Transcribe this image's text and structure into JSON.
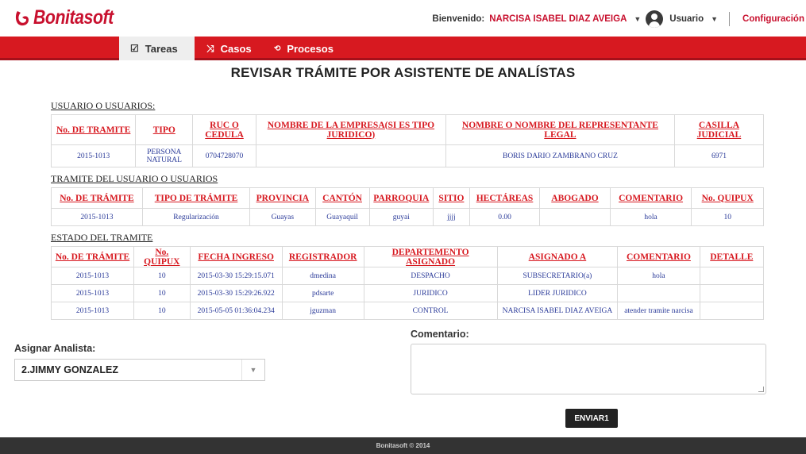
{
  "brand": {
    "name": "Bonitasoft"
  },
  "userbar": {
    "welcome": "Bienvenido:",
    "user_name": "NARCISA ISABEL DIAZ AVEIGA",
    "user_menu": "Usuario",
    "settings": "Configuración"
  },
  "nav": {
    "tabs": [
      {
        "label": "Tareas",
        "icon": "checkbox-icon"
      },
      {
        "label": "Casos",
        "icon": "shuffle-icon"
      },
      {
        "label": "Procesos",
        "icon": "process-icon"
      }
    ],
    "active_tab": "Tareas"
  },
  "page_title": "REVISAR TRÁMITE POR ASISTENTE DE ANALÍSTAS",
  "usuarios": {
    "title": "USUARIO O USUARIOS:",
    "headers": [
      "No. DE TRAMITE",
      "TIPO",
      "RUC O CEDULA",
      "NOMBRE DE LA EMPRESA(SI ES TIPO JURIDICO)",
      "NOMBRE O NOMBRE DEL REPRESENTANTE LEGAL",
      "CASILLA JUDICIAL"
    ],
    "rows": [
      [
        "2015-1013",
        "PERSONA NATURAL",
        "0704728070",
        "",
        "BORIS DARIO ZAMBRANO CRUZ",
        "6971"
      ]
    ]
  },
  "tramite": {
    "title": "TRAMITE DEL USUARIO O USUARIOS",
    "headers": [
      "No. DE TRÁMITE",
      "TIPO DE TRÁMITE",
      "PROVINCIA",
      "CANTÓN",
      "PARROQUIA",
      "SITIO",
      "HECTÁREAS",
      "ABOGADO",
      "COMENTARIO",
      "No. QUIPUX"
    ],
    "rows": [
      [
        "2015-1013",
        "Regularización",
        "Guayas",
        "Guayaquil",
        "guyai",
        "jjjj",
        "0.00",
        "",
        "hola",
        "10"
      ]
    ]
  },
  "estado": {
    "title": "ESTADO DEL TRAMITE",
    "headers": [
      "No. DE TRÁMITE",
      "No. QUIPUX",
      "FECHA INGRESO",
      "REGISTRADOR",
      "DEPARTEMENTO ASIGNADO",
      "ASIGNADO A",
      "COMENTARIO",
      "DETALLE"
    ],
    "rows": [
      [
        "2015-1013",
        "10",
        "2015-03-30 15:29:15.071",
        "dmedina",
        "DESPACHO",
        "SUBSECRETARIO(a)",
        "hola",
        ""
      ],
      [
        "2015-1013",
        "10",
        "2015-03-30 15:29:26.922",
        "pdsarte",
        "JURIDICO",
        "LIDER JURIDICO",
        "",
        ""
      ],
      [
        "2015-1013",
        "10",
        "2015-05-05 01:36:04.234",
        "jguzman",
        "CONTROL",
        "NARCISA ISABEL DIAZ AVEIGA",
        "atender tramite narcisa",
        ""
      ]
    ]
  },
  "form": {
    "analyst_label": "Asignar Analista:",
    "analyst_value": "2.JIMMY GONZALEZ",
    "comment_label": "Comentario:",
    "comment_value": "",
    "submit_label": "ENVIAR1"
  },
  "footer": {
    "text": "Bonitasoft © 2014"
  },
  "colors": {
    "brand_red": "#d71920",
    "link_blue": "#2a3a99",
    "footer_bg": "#333333"
  }
}
